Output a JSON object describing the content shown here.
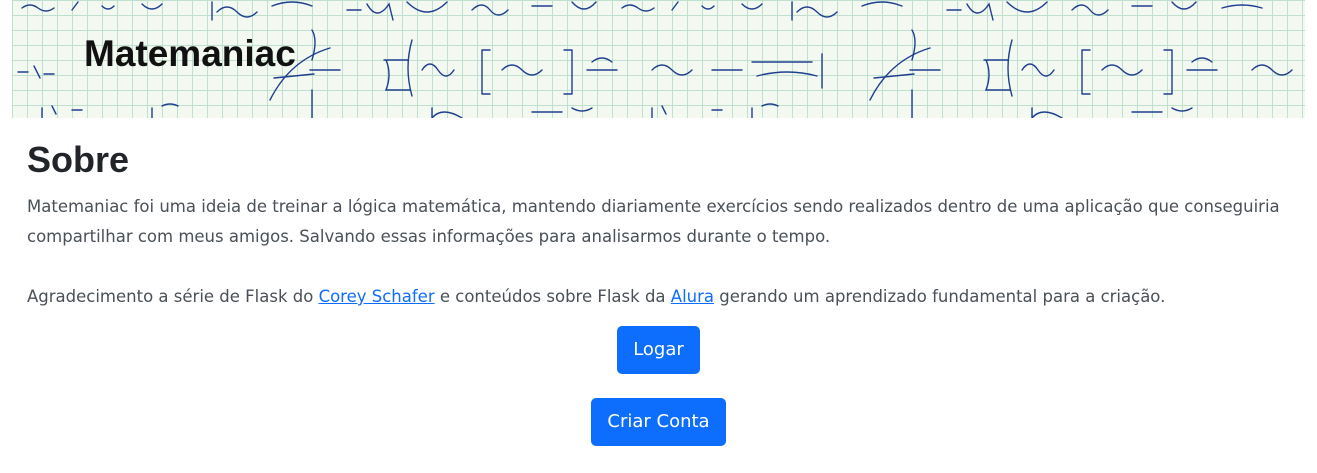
{
  "header": {
    "brand": "Matemaniac"
  },
  "about": {
    "title": "Sobre",
    "paragraph1": "Matemaniac foi uma ideia de treinar a lógica matemática, mantendo diariamente exercícios sendo realizados dentro de uma aplicação que conseguiria compartilhar com meus amigos. Salvando essas informações para analisarmos durante o tempo.",
    "paragraph2_prefix": "Agradecimento a série de Flask do ",
    "link_corey": "Corey Schafer",
    "paragraph2_middle": " e conteúdos sobre Flask da ",
    "link_alura": "Alura",
    "paragraph2_suffix": " gerando um aprendizado fundamental para a criação."
  },
  "actions": {
    "login_label": "Logar",
    "signup_label": "Criar Conta"
  },
  "colors": {
    "primary": "#0d6efd",
    "banner_grid": "#bfe0cf",
    "banner_bg": "#f3f8f1",
    "ink": "#1f3f8f"
  }
}
